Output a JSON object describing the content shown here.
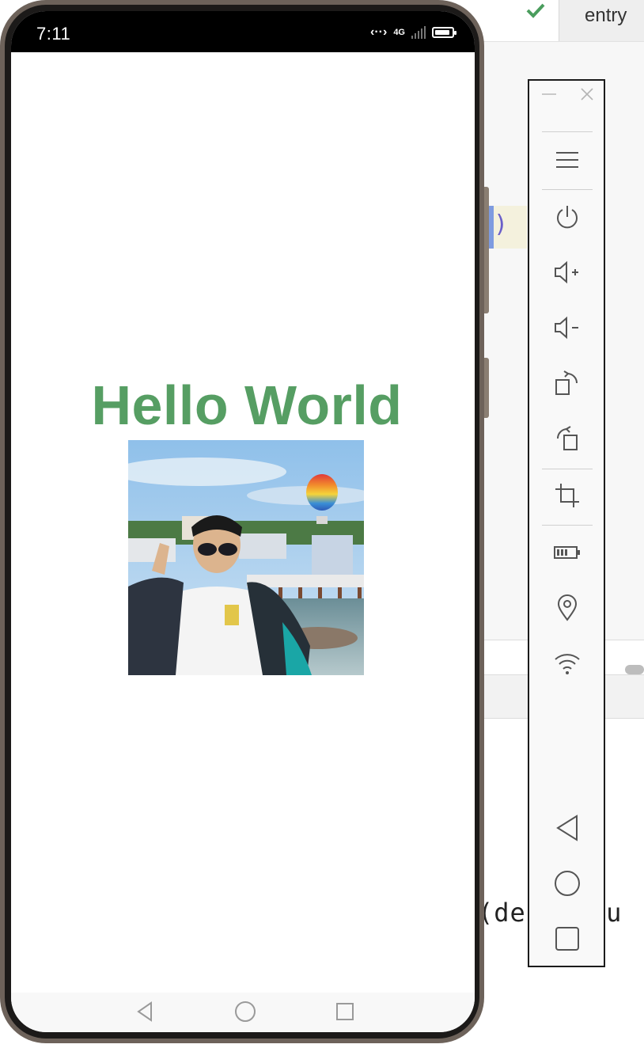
{
  "ide": {
    "tab_label": "entry",
    "highlight_char": ")",
    "code_text": "(def  You"
  },
  "phone": {
    "status": {
      "time": "7:11",
      "network_label": "4G"
    },
    "hello_text": "Hello World",
    "photo_description_icon": "photo-image",
    "nav": {
      "back": "back-icon",
      "home": "home-icon",
      "recents": "recents-icon"
    }
  },
  "toolbar": {
    "items": [
      {
        "name": "menu",
        "icon": "menu-icon"
      },
      {
        "name": "power",
        "icon": "power-icon"
      },
      {
        "name": "volume-up",
        "icon": "volume-up-icon"
      },
      {
        "name": "volume-down",
        "icon": "volume-down-icon"
      },
      {
        "name": "rotate-right",
        "icon": "rotate-right-icon"
      },
      {
        "name": "rotate-left",
        "icon": "rotate-left-icon"
      },
      {
        "name": "screenshot",
        "icon": "crop-icon"
      },
      {
        "name": "battery",
        "icon": "battery-icon"
      },
      {
        "name": "location",
        "icon": "location-icon"
      },
      {
        "name": "wifi",
        "icon": "wifi-icon"
      },
      {
        "name": "back",
        "icon": "back-icon"
      },
      {
        "name": "home",
        "icon": "home-icon"
      },
      {
        "name": "recents",
        "icon": "recents-icon"
      }
    ]
  },
  "colors": {
    "hello_green": "#569e63",
    "check_green": "#4a9d5d",
    "toolbar_icon": "#555555"
  }
}
